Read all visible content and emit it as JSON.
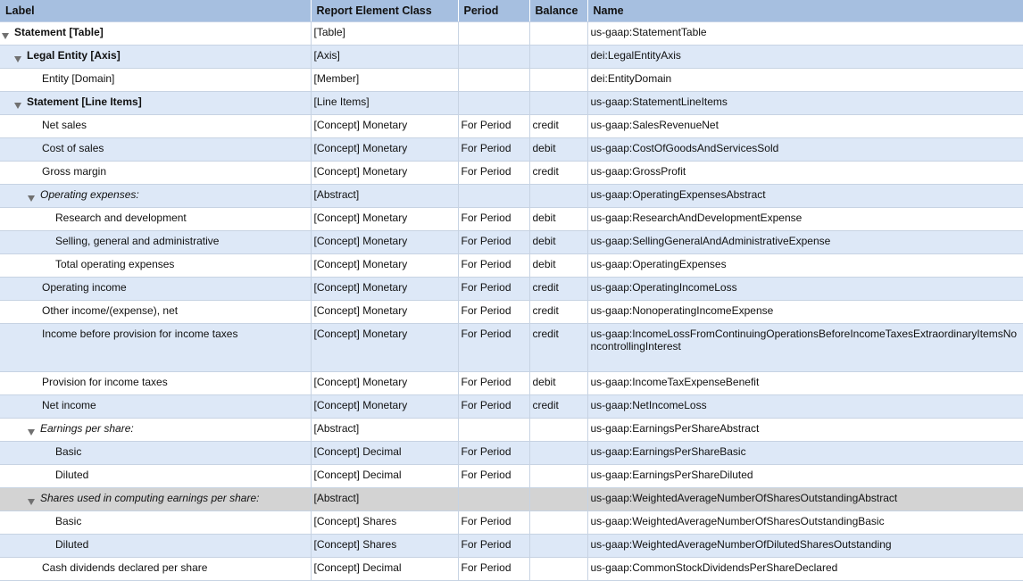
{
  "columns": [
    "Label",
    "Report Element Class",
    "Period",
    "Balance",
    "Name"
  ],
  "rows": [
    {
      "label": "Statement [Table]",
      "class": "[Table]",
      "period": "",
      "balance": "",
      "name": "us-gaap:StatementTable"
    },
    {
      "label": "Legal Entity [Axis]",
      "class": "[Axis]",
      "period": "",
      "balance": "",
      "name": "dei:LegalEntityAxis"
    },
    {
      "label": "Entity [Domain]",
      "class": "[Member]",
      "period": "",
      "balance": "",
      "name": "dei:EntityDomain"
    },
    {
      "label": "Statement [Line Items]",
      "class": "[Line Items]",
      "period": "",
      "balance": "",
      "name": "us-gaap:StatementLineItems"
    },
    {
      "label": "Net sales",
      "class": "[Concept] Monetary",
      "period": "For Period",
      "balance": "credit",
      "name": "us-gaap:SalesRevenueNet"
    },
    {
      "label": "Cost of sales",
      "class": "[Concept] Monetary",
      "period": "For Period",
      "balance": "debit",
      "name": "us-gaap:CostOfGoodsAndServicesSold"
    },
    {
      "label": "Gross margin",
      "class": "[Concept] Monetary",
      "period": "For Period",
      "balance": "credit",
      "name": "us-gaap:GrossProfit"
    },
    {
      "label": "Operating expenses:",
      "class": "[Abstract]",
      "period": "",
      "balance": "",
      "name": "us-gaap:OperatingExpensesAbstract"
    },
    {
      "label": "Research and development",
      "class": "[Concept] Monetary",
      "period": "For Period",
      "balance": "debit",
      "name": "us-gaap:ResearchAndDevelopmentExpense"
    },
    {
      "label": "Selling, general and administrative",
      "class": "[Concept] Monetary",
      "period": "For Period",
      "balance": "debit",
      "name": "us-gaap:SellingGeneralAndAdministrativeExpense"
    },
    {
      "label": "Total operating expenses",
      "class": "[Concept] Monetary",
      "period": "For Period",
      "balance": "debit",
      "name": "us-gaap:OperatingExpenses"
    },
    {
      "label": "Operating income",
      "class": "[Concept] Monetary",
      "period": "For Period",
      "balance": "credit",
      "name": "us-gaap:OperatingIncomeLoss"
    },
    {
      "label": "Other income/(expense), net",
      "class": "[Concept] Monetary",
      "period": "For Period",
      "balance": "credit",
      "name": "us-gaap:NonoperatingIncomeExpense"
    },
    {
      "label": "Income before provision for income taxes",
      "class": "[Concept] Monetary",
      "period": "For Period",
      "balance": "credit",
      "name": "us-gaap:IncomeLossFromContinuingOperationsBeforeIncomeTaxesExtraordinaryItemsNoncontrollingInterest"
    },
    {
      "label": "Provision for income taxes",
      "class": "[Concept] Monetary",
      "period": "For Period",
      "balance": "debit",
      "name": "us-gaap:IncomeTaxExpenseBenefit"
    },
    {
      "label": "Net income",
      "class": "[Concept] Monetary",
      "period": "For Period",
      "balance": "credit",
      "name": "us-gaap:NetIncomeLoss"
    },
    {
      "label": "Earnings per share:",
      "class": "[Abstract]",
      "period": "",
      "balance": "",
      "name": "us-gaap:EarningsPerShareAbstract"
    },
    {
      "label": "Basic",
      "class": "[Concept] Decimal",
      "period": "For Period",
      "balance": "",
      "name": "us-gaap:EarningsPerShareBasic"
    },
    {
      "label": "Diluted",
      "class": "[Concept] Decimal",
      "period": "For Period",
      "balance": "",
      "name": "us-gaap:EarningsPerShareDiluted"
    },
    {
      "label": "Shares used in computing earnings per share:",
      "class": "[Abstract]",
      "period": "",
      "balance": "",
      "name": "us-gaap:WeightedAverageNumberOfSharesOutstandingAbstract"
    },
    {
      "label": "Basic",
      "class": "[Concept] Shares",
      "period": "For Period",
      "balance": "",
      "name": "us-gaap:WeightedAverageNumberOfSharesOutstandingBasic"
    },
    {
      "label": "Diluted",
      "class": "[Concept] Shares",
      "period": "For Period",
      "balance": "",
      "name": "us-gaap:WeightedAverageNumberOfDilutedSharesOutstanding"
    },
    {
      "label": "Cash dividends declared per share",
      "class": "[Concept] Decimal",
      "period": "For Period",
      "balance": "",
      "name": "us-gaap:CommonStockDividendsPerShareDeclared"
    }
  ]
}
